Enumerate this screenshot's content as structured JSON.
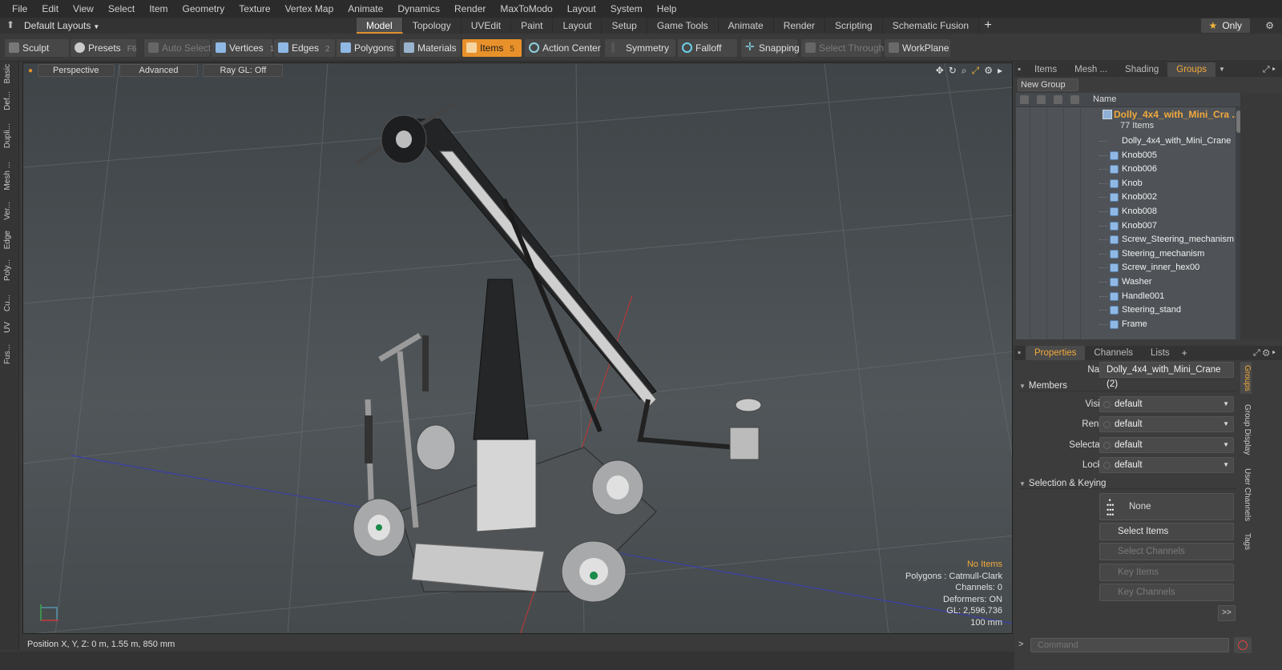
{
  "menu": [
    "File",
    "Edit",
    "View",
    "Select",
    "Item",
    "Geometry",
    "Texture",
    "Vertex Map",
    "Animate",
    "Dynamics",
    "Render",
    "MaxToModo",
    "Layout",
    "System",
    "Help"
  ],
  "layout_select": "Default Layouts",
  "layout_tabs": [
    "Model",
    "Topology",
    "UVEdit",
    "Paint",
    "Layout",
    "Setup",
    "Game Tools",
    "Animate",
    "Render",
    "Scripting",
    "Schematic Fusion"
  ],
  "only_label": "Only",
  "toolbar": {
    "sculpt": "Sculpt",
    "presets": "Presets",
    "presets_key": "F6",
    "auto_select": "Auto Select",
    "vertices": "Vertices",
    "vertices_key": "1",
    "edges": "Edges",
    "edges_key": "2",
    "polygons": "Polygons",
    "materials": "Materials",
    "items": "Items",
    "items_key": "5",
    "action_center": "Action Center",
    "symmetry": "Symmetry",
    "falloff": "Falloff",
    "snapping": "Snapping",
    "select_through": "Select Through",
    "workplane": "WorkPlane"
  },
  "left_tabs": [
    "Basic",
    "Def...",
    "Dupli...",
    "Mesh ...",
    "Ver...",
    "Edge",
    "Poly...",
    "Cu...",
    "UV",
    "Fus..."
  ],
  "viewport": {
    "view": "Perspective",
    "shading": "Advanced",
    "raygl": "Ray GL: Off",
    "info": {
      "no_items": "No Items",
      "polygons": "Polygons : Catmull-Clark",
      "channels": "Channels: 0",
      "deformers": "Deformers: ON",
      "gl": "GL: 2,596,736",
      "scale": "100 mm"
    }
  },
  "status": "Position X, Y, Z:   0 m, 1.55 m, 850 mm",
  "items_panel": {
    "tabs": [
      "Items",
      "Mesh ...",
      "Shading",
      "Groups"
    ],
    "new_group": "New Group",
    "name_header": "Name",
    "group_name": "Dolly_4x4_with_Mini_Cra ...",
    "group_count": "77 Items",
    "rows": [
      "Dolly_4x4_with_Mini_Crane",
      "Knob005",
      "Knob006",
      "Knob",
      "Knob002",
      "Knob008",
      "Knob007",
      "Screw_Steering_mechanism",
      "Steering_mechanism",
      "Screw_inner_hex00",
      "Washer",
      "Handle001",
      "Steering_stand",
      "Frame"
    ]
  },
  "properties": {
    "tabs": [
      "Properties",
      "Channels",
      "Lists"
    ],
    "name_label": "Name",
    "name_value": "Dolly_4x4_with_Mini_Crane (2)",
    "members_section": "Members",
    "visible_label": "Visible",
    "visible_value": "default",
    "render_label": "Render",
    "render_value": "default",
    "selectable_label": "Selectable",
    "selectable_value": "default",
    "locked_label": "Locked",
    "locked_value": "default",
    "selection_section": "Selection & Keying",
    "none_label": "None",
    "select_items": "Select Items",
    "select_channels": "Select Channels",
    "key_items": "Key Items",
    "key_channels": "Key Channels",
    "more": ">>",
    "side_tabs": [
      "Groups",
      "Group Display",
      "User Channels",
      "Tags"
    ]
  },
  "command_placeholder": "Command",
  "colors": {
    "accent": "#e8912b",
    "highlight_text": "#f2a93b",
    "item_icon": "#8fb8e4"
  }
}
